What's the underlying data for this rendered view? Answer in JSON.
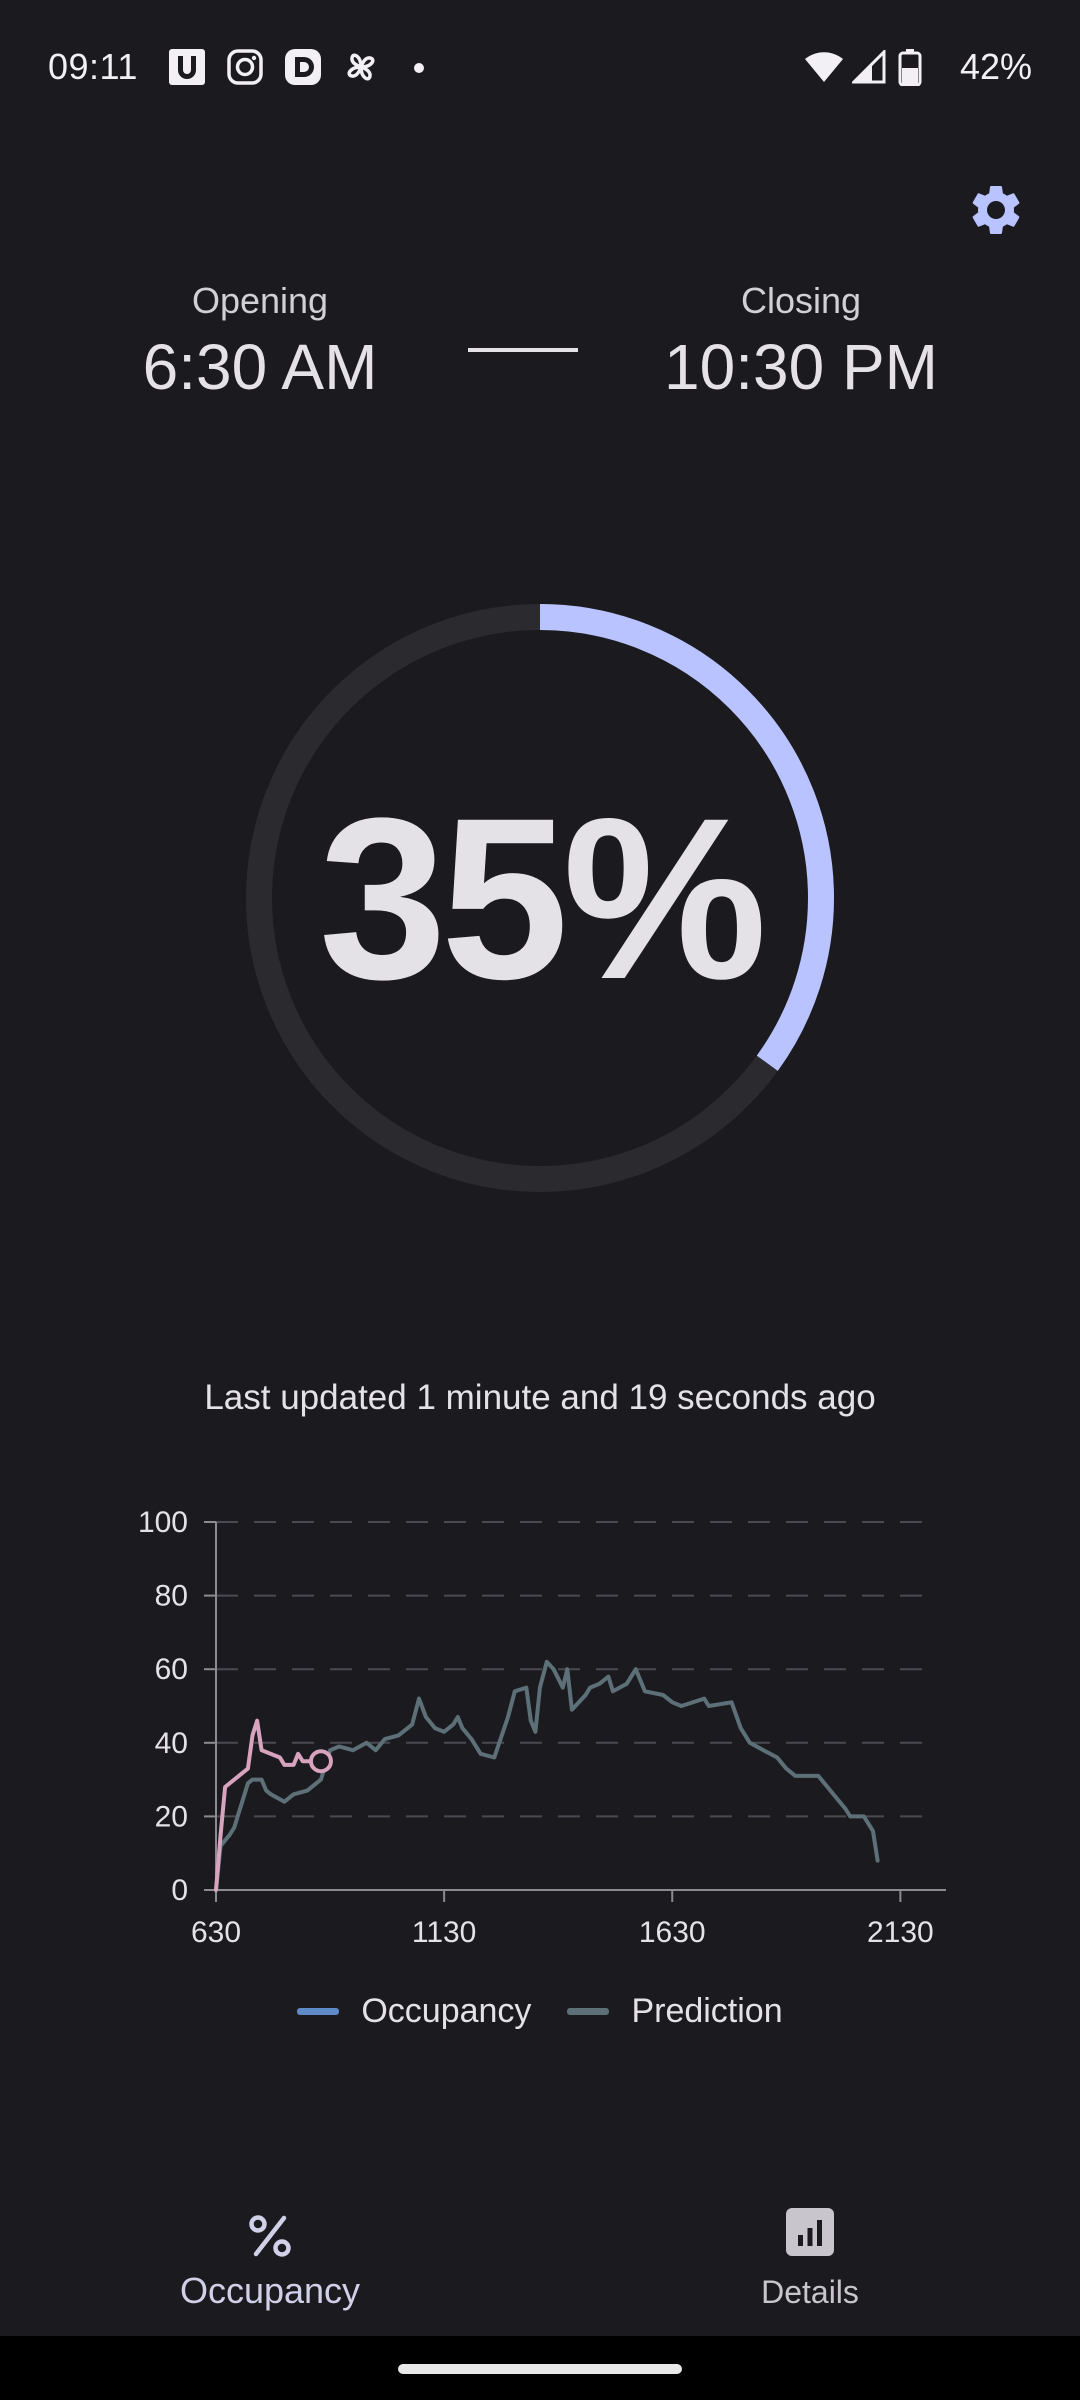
{
  "status_bar": {
    "time": "09:11",
    "notification_icons": [
      "u-app-icon",
      "instagram-icon",
      "dp-app-icon",
      "pinwheel-icon",
      "dot-icon"
    ],
    "battery_percent": "42%"
  },
  "header": {
    "settings_icon": "gear-icon"
  },
  "hours": {
    "opening_label": "Opening",
    "opening_time": "6:30 AM",
    "closing_label": "Closing",
    "closing_time": "10:30 PM"
  },
  "occupancy": {
    "value_text": "35%",
    "fraction": 0.35,
    "colors": {
      "arc": "#b9c3ff",
      "track": "#2b2b2f"
    }
  },
  "last_updated": "Last updated 1 minute and 19 seconds ago",
  "legend": {
    "occupancy": "Occupancy",
    "prediction": "Prediction"
  },
  "chart_data": {
    "type": "line",
    "xlim": [
      630,
      2230
    ],
    "ylim": [
      0,
      100
    ],
    "x_ticks": [
      "630",
      "1130",
      "1630",
      "2130"
    ],
    "y_ticks": [
      "0",
      "20",
      "40",
      "60",
      "80",
      "100"
    ],
    "grid": "horizontal-dashed",
    "legend_position": "bottom",
    "series": [
      {
        "name": "Occupancy",
        "color": "#d7a3be",
        "points": [
          [
            630,
            0
          ],
          [
            640,
            15
          ],
          [
            650,
            28
          ],
          [
            700,
            33
          ],
          [
            710,
            42
          ],
          [
            720,
            46
          ],
          [
            730,
            38
          ],
          [
            770,
            36
          ],
          [
            780,
            34
          ],
          [
            800,
            34
          ],
          [
            810,
            37
          ],
          [
            820,
            35
          ],
          [
            860,
            35
          ]
        ],
        "marker_last": true
      },
      {
        "name": "Prediction",
        "color": "#5d7078",
        "points": [
          [
            630,
            0
          ],
          [
            640,
            12
          ],
          [
            660,
            15
          ],
          [
            670,
            17
          ],
          [
            680,
            21
          ],
          [
            690,
            25
          ],
          [
            700,
            29
          ],
          [
            710,
            30
          ],
          [
            730,
            30
          ],
          [
            740,
            27
          ],
          [
            750,
            26
          ],
          [
            780,
            24
          ],
          [
            800,
            26
          ],
          [
            830,
            27
          ],
          [
            860,
            30
          ],
          [
            880,
            38
          ],
          [
            900,
            39
          ],
          [
            930,
            38
          ],
          [
            960,
            40
          ],
          [
            980,
            38
          ],
          [
            1000,
            41
          ],
          [
            1030,
            42
          ],
          [
            1060,
            45
          ],
          [
            1075,
            52
          ],
          [
            1090,
            47
          ],
          [
            1110,
            44
          ],
          [
            1130,
            43
          ],
          [
            1150,
            45
          ],
          [
            1160,
            47
          ],
          [
            1170,
            44
          ],
          [
            1190,
            41
          ],
          [
            1210,
            37
          ],
          [
            1240,
            36
          ],
          [
            1270,
            47
          ],
          [
            1285,
            54
          ],
          [
            1310,
            55
          ],
          [
            1320,
            46
          ],
          [
            1330,
            43
          ],
          [
            1340,
            55
          ],
          [
            1355,
            62
          ],
          [
            1370,
            60
          ],
          [
            1390,
            55
          ],
          [
            1400,
            60
          ],
          [
            1410,
            49
          ],
          [
            1440,
            53
          ],
          [
            1450,
            55
          ],
          [
            1470,
            56
          ],
          [
            1490,
            58
          ],
          [
            1500,
            54
          ],
          [
            1530,
            56
          ],
          [
            1550,
            60
          ],
          [
            1570,
            54
          ],
          [
            1610,
            53
          ],
          [
            1630,
            51
          ],
          [
            1650,
            50
          ],
          [
            1700,
            52
          ],
          [
            1710,
            50
          ],
          [
            1760,
            51
          ],
          [
            1780,
            44
          ],
          [
            1800,
            40
          ],
          [
            1830,
            38
          ],
          [
            1860,
            36
          ],
          [
            1880,
            33
          ],
          [
            1900,
            31
          ],
          [
            1950,
            31
          ],
          [
            1990,
            25
          ],
          [
            2010,
            22
          ],
          [
            2020,
            20
          ],
          [
            2050,
            20
          ],
          [
            2070,
            16
          ],
          [
            2080,
            8
          ]
        ]
      }
    ]
  },
  "bottom_nav": {
    "occupancy_label": "Occupancy",
    "details_label": "Details"
  }
}
